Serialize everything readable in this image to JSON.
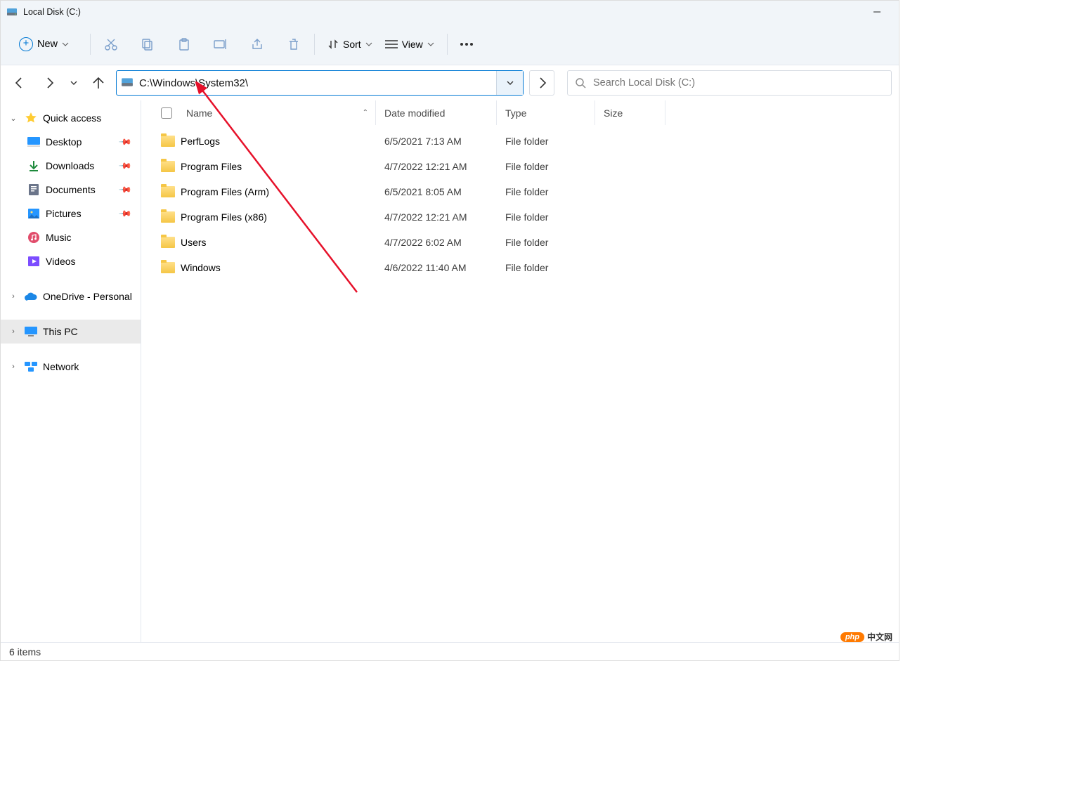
{
  "window": {
    "title": "Local Disk (C:)"
  },
  "toolbar": {
    "new_label": "New",
    "sort_label": "Sort",
    "view_label": "View"
  },
  "address": {
    "path": "C:\\Windows\\System32\\"
  },
  "search": {
    "placeholder": "Search Local Disk (C:)"
  },
  "sidebar": {
    "quick_access": "Quick access",
    "desktop": "Desktop",
    "downloads": "Downloads",
    "documents": "Documents",
    "pictures": "Pictures",
    "music": "Music",
    "videos": "Videos",
    "onedrive": "OneDrive - Personal",
    "this_pc": "This PC",
    "network": "Network"
  },
  "columns": {
    "name": "Name",
    "date": "Date modified",
    "type": "Type",
    "size": "Size"
  },
  "rows": [
    {
      "name": "PerfLogs",
      "date": "6/5/2021 7:13 AM",
      "type": "File folder"
    },
    {
      "name": "Program Files",
      "date": "4/7/2022 12:21 AM",
      "type": "File folder"
    },
    {
      "name": "Program Files (Arm)",
      "date": "6/5/2021 8:05 AM",
      "type": "File folder"
    },
    {
      "name": "Program Files (x86)",
      "date": "4/7/2022 12:21 AM",
      "type": "File folder"
    },
    {
      "name": "Users",
      "date": "4/7/2022 6:02 AM",
      "type": "File folder"
    },
    {
      "name": "Windows",
      "date": "4/6/2022 11:40 AM",
      "type": "File folder"
    }
  ],
  "status": {
    "text": "6 items"
  },
  "watermark": {
    "badge": "php",
    "text": "中文网"
  }
}
